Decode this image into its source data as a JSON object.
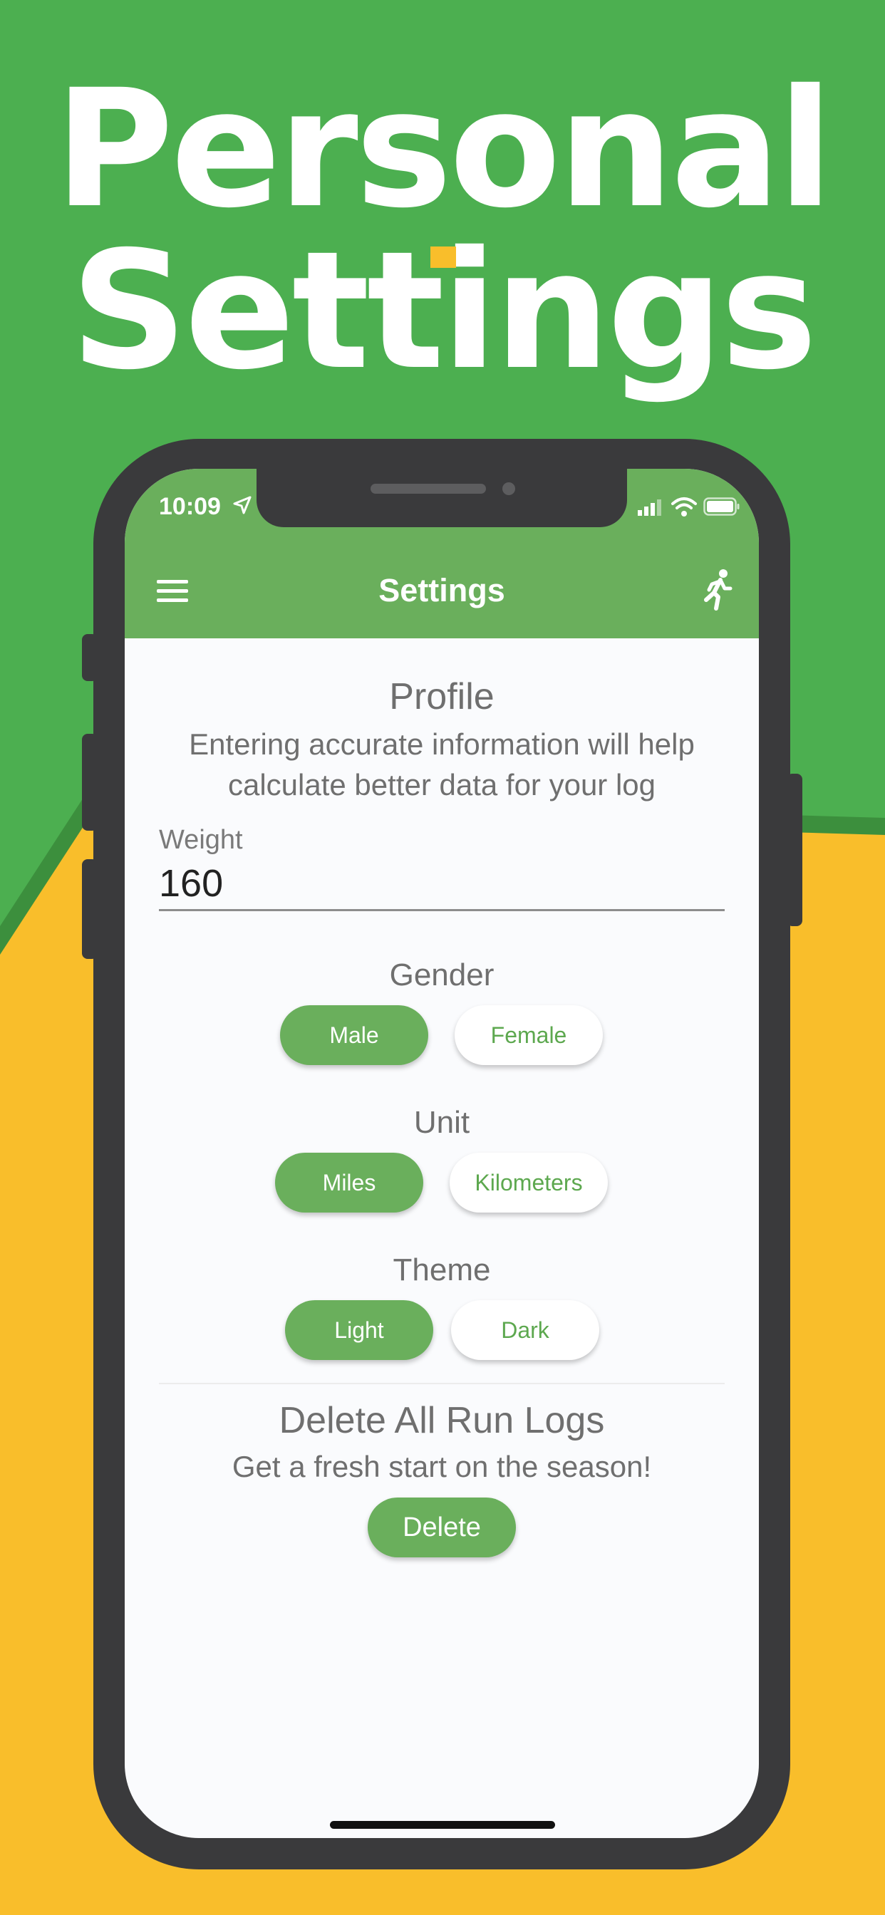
{
  "banner": {
    "line1": "Personal",
    "line2": "Settings"
  },
  "colors": {
    "brand_green": "#4caf50",
    "header_green": "#6aaf5c",
    "accent_yellow": "#f9be2b",
    "phone_frame": "#3a3a3c"
  },
  "status_bar": {
    "time": "10:09",
    "icons": [
      "location-arrow-icon",
      "cellular-signal-icon",
      "wifi-icon",
      "battery-icon"
    ]
  },
  "header": {
    "title": "Settings",
    "left_icon": "hamburger-menu-icon",
    "right_icon": "running-man-icon"
  },
  "profile": {
    "title": "Profile",
    "description": "Entering accurate information will help calculate better data for your log",
    "weight_label": "Weight",
    "weight_value": "160"
  },
  "gender": {
    "label": "Gender",
    "options": [
      "Male",
      "Female"
    ],
    "selected": "Male"
  },
  "unit": {
    "label": "Unit",
    "options": [
      "Miles",
      "Kilometers"
    ],
    "selected": "Miles"
  },
  "theme": {
    "label": "Theme",
    "options": [
      "Light",
      "Dark"
    ],
    "selected": "Light"
  },
  "delete_section": {
    "title": "Delete All Run Logs",
    "description": "Get a fresh start on the season!",
    "button_label": "Delete"
  }
}
